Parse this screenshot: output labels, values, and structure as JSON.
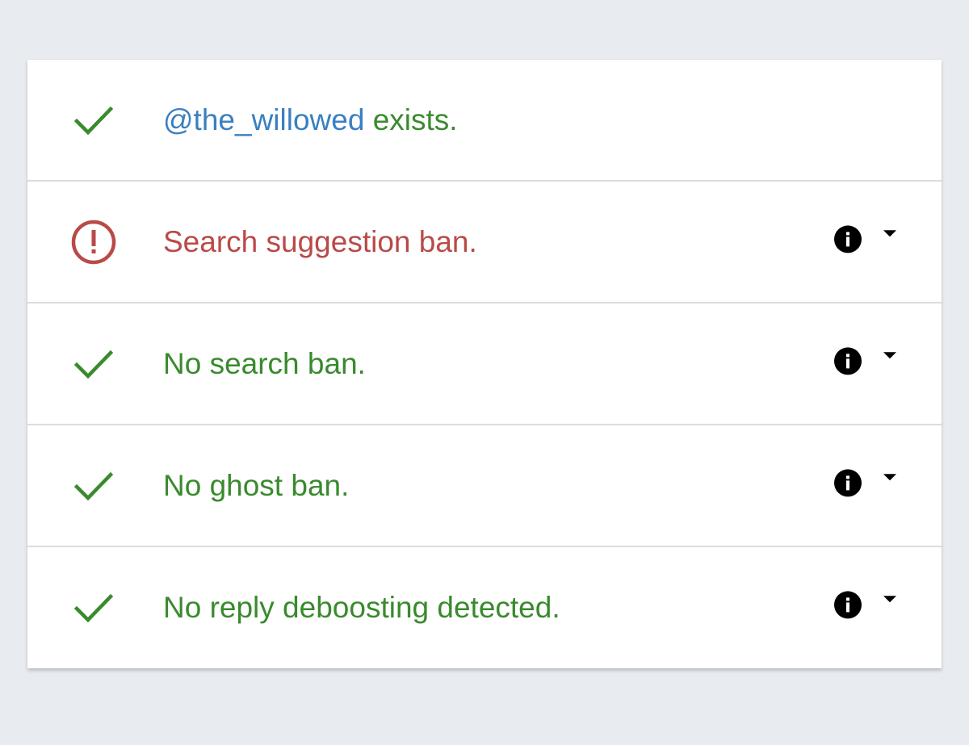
{
  "colors": {
    "background": "#e8ebef",
    "ok": "#3a8a2e",
    "error": "#b94a48",
    "handle": "#3a7fc1"
  },
  "checks": [
    {
      "status": "ok",
      "status_icon": "check-icon",
      "handle": "@the_willowed",
      "text": " exists.",
      "has_details": false
    },
    {
      "status": "error",
      "status_icon": "exclamation-circle-icon",
      "text": "Search suggestion ban.",
      "has_details": true,
      "details_icon": "info-icon",
      "expand_icon": "caret-down-icon"
    },
    {
      "status": "ok",
      "status_icon": "check-icon",
      "text": "No search ban.",
      "has_details": true,
      "details_icon": "info-icon",
      "expand_icon": "caret-down-icon"
    },
    {
      "status": "ok",
      "status_icon": "check-icon",
      "text": "No ghost ban.",
      "has_details": true,
      "details_icon": "info-icon",
      "expand_icon": "caret-down-icon"
    },
    {
      "status": "ok",
      "status_icon": "check-icon",
      "text": "No reply deboosting detected.",
      "has_details": true,
      "details_icon": "info-icon",
      "expand_icon": "caret-down-icon"
    }
  ]
}
